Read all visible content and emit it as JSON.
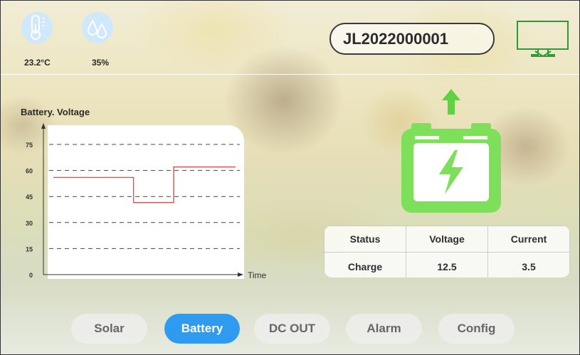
{
  "environment": {
    "temperature": {
      "icon": "thermometer-icon",
      "value": "23.2°C"
    },
    "humidity": {
      "icon": "humidity-drops-icon",
      "value": "35%"
    }
  },
  "header": {
    "device_id": "JL2022000001",
    "monitor_icon": "monitor-icon",
    "accent_color": "#2e9b3a"
  },
  "battery": {
    "icon": "battery-charging-icon",
    "direction_icon": "arrow-up-icon",
    "color": "#7ee05a"
  },
  "chart_data": {
    "type": "line",
    "title": "Battery. Voltage",
    "xlabel": "Time",
    "ylabel": "",
    "yticks": [
      "75",
      "60",
      "45",
      "30",
      "15",
      "0"
    ],
    "ylim": [
      0,
      75
    ],
    "grid": true,
    "series": [
      {
        "color": "#d9534f",
        "x": [
          0,
          0.44,
          0.44,
          0.66,
          0.66,
          1.0
        ],
        "values": [
          56,
          56,
          41.5,
          41.5,
          62,
          62
        ]
      }
    ]
  },
  "status_table": {
    "headers": [
      "Status",
      "Voltage",
      "Current"
    ],
    "rows": [
      [
        "Charge",
        "12.5",
        "3.5"
      ]
    ]
  },
  "tabs": {
    "items": [
      "Solar",
      "Battery",
      "DC OUT",
      "Alarm",
      "Config"
    ],
    "active": "Battery",
    "active_color": "#2f9bf0"
  }
}
